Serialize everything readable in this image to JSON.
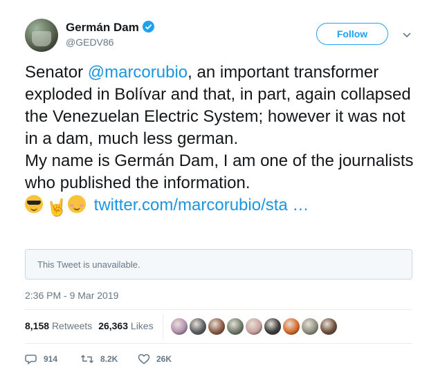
{
  "author": {
    "name": "Germán Dam",
    "handle": "@GEDV86",
    "verified": true
  },
  "follow_button": {
    "label": "Follow"
  },
  "tweet": {
    "text_prefix": "Senator ",
    "mention": "@marcorubio",
    "text_part1": ", an important transformer exploded in Bolívar and that, in part, again collapsed the Venezuelan Electric System; however it was not in a dam, much less german.",
    "text_part2": "My name is Germán Dam, I am one of the journalists who published the information.",
    "emojis": [
      "sunglasses-face-icon",
      "sign-of-horns-icon",
      "smiling-face-icon"
    ],
    "horns_glyph": "🤘",
    "link": "twitter.com/marcorubio/sta …"
  },
  "quoted": {
    "text": "This Tweet is unavailable."
  },
  "timestamp": "2:36 PM - 9 Mar 2019",
  "stats": {
    "retweets_count": "8,158",
    "retweets_label": "Retweets",
    "likes_count": "26,363",
    "likes_label": "Likes"
  },
  "likers_colors": [
    "#b48fb0",
    "#5b5d63",
    "#8a5a45",
    "#6f7b6a",
    "#c9a29d",
    "#3b3b3b",
    "#d86a2a",
    "#8d8f7f",
    "#6d4f3a"
  ],
  "actions": {
    "replies": "914",
    "retweets": "8.2K",
    "likes": "26K"
  },
  "colors": {
    "accent": "#1da1f2",
    "link": "#1b95e0",
    "muted": "#657786"
  }
}
